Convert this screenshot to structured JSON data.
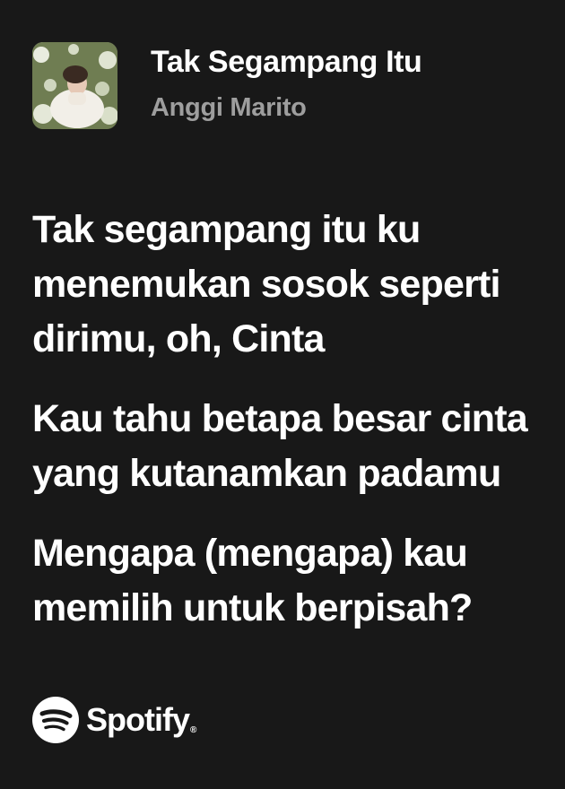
{
  "track": {
    "title": "Tak Segampang Itu",
    "artist": "Anggi Marito",
    "cover_icon": "album-cover-image"
  },
  "lyrics": [
    {
      "text": "Tak segampang itu ku menemukan sosok seperti dirimu, oh, Cinta"
    },
    {
      "text": "Kau tahu betapa besar cinta yang kutanamkan padamu"
    },
    {
      "text": "Mengapa (mengapa) kau memilih untuk berpisah?"
    }
  ],
  "brand": {
    "name": "Spotify",
    "registered": "®",
    "icon": "spotify-logo-icon"
  },
  "colors": {
    "background": "#181818",
    "primary_text": "#ffffff",
    "secondary_text": "#9e9e9e"
  }
}
